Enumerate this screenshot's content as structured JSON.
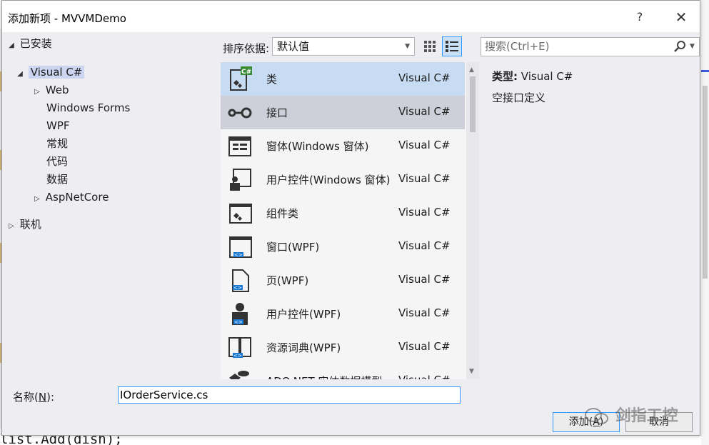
{
  "background": {
    "code_fragment": "list.Add(dish);"
  },
  "dialog": {
    "title": "添加新项 - MVVMDemo",
    "help_label": "?",
    "close_label": "✕"
  },
  "tree": {
    "installed": "已安装",
    "visual_csharp": "Visual C#",
    "web": "Web",
    "windows_forms": "Windows Forms",
    "wpf": "WPF",
    "general": "常规",
    "code": "代码",
    "data": "数据",
    "aspnetcore": "AspNetCore",
    "online": "联机"
  },
  "toolbar": {
    "sort_label": "排序依据:",
    "sort_value": "默认值",
    "search_placeholder": "搜索(Ctrl+E)"
  },
  "templates": [
    {
      "name": "类",
      "lang": "Visual C#",
      "icon": "class-icon"
    },
    {
      "name": "接口",
      "lang": "Visual C#",
      "icon": "interface-icon"
    },
    {
      "name": "窗体(Windows 窗体)",
      "lang": "Visual C#",
      "icon": "form-icon"
    },
    {
      "name": "用户控件(Windows 窗体)",
      "lang": "Visual C#",
      "icon": "user-control-icon"
    },
    {
      "name": "组件类",
      "lang": "Visual C#",
      "icon": "component-class-icon"
    },
    {
      "name": "窗口(WPF)",
      "lang": "Visual C#",
      "icon": "wpf-window-icon"
    },
    {
      "name": "页(WPF)",
      "lang": "Visual C#",
      "icon": "wpf-page-icon"
    },
    {
      "name": "用户控件(WPF)",
      "lang": "Visual C#",
      "icon": "wpf-user-control-icon"
    },
    {
      "name": "资源词典(WPF)",
      "lang": "Visual C#",
      "icon": "resource-dictionary-icon"
    },
    {
      "name": "ADO.NET 实体数据模型",
      "lang": "Visual C#",
      "icon": "ado-net-icon"
    }
  ],
  "description": {
    "type_label": "类型:",
    "type_value": "Visual C#",
    "text": "空接口定义"
  },
  "bottom": {
    "name_label_pre": "名称(",
    "name_label_key": "N",
    "name_label_post": "):",
    "name_value": "IOrderService.cs",
    "add_pre": "添加(",
    "add_key": "A",
    "add_post": ")",
    "cancel_label": "取消"
  },
  "watermark": {
    "text": "剑指工控"
  },
  "colors": {
    "selected_row": "#c7dcf2",
    "hover_row": "#cdd0d8",
    "accent": "#3399ff"
  }
}
